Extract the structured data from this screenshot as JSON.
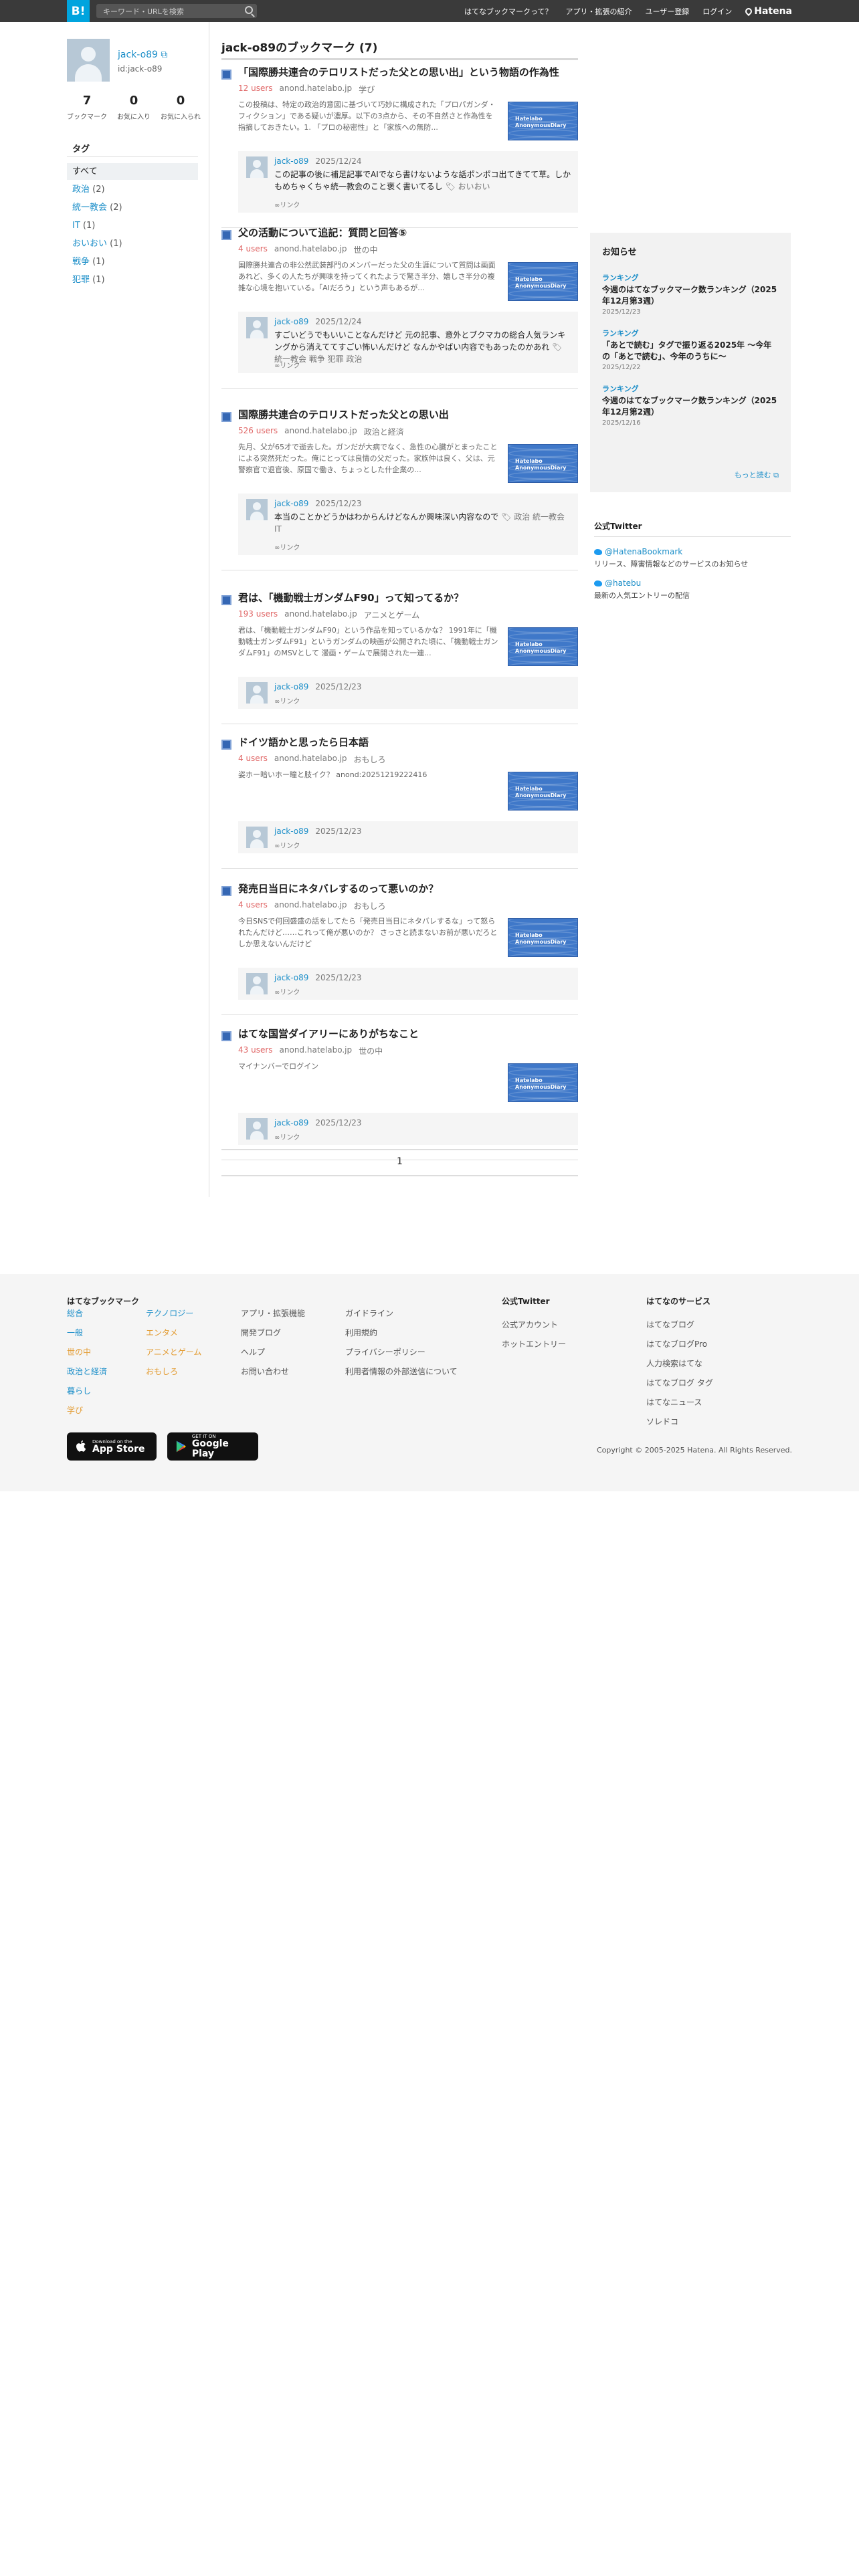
{
  "topbar": {
    "logo": "B!",
    "search_placeholder": "キーワード・URLを検索",
    "nav": [
      "はてなブックマークって？",
      "アプリ・拡張の紹介",
      "ユーザー登録",
      "ログイン"
    ],
    "hatena": "Hatena"
  },
  "profile": {
    "name": "jack-o89",
    "id": "id:jack-o89",
    "stats": [
      {
        "n": "7",
        "l": "ブックマーク"
      },
      {
        "n": "0",
        "l": "お気に入り"
      },
      {
        "n": "0",
        "l": "お気に入られ"
      }
    ]
  },
  "tags": {
    "title": "タグ",
    "items": [
      {
        "label": "すべて",
        "count": ""
      },
      {
        "label": "政治",
        "count": "(2)"
      },
      {
        "label": "統一教会",
        "count": "(2)"
      },
      {
        "label": "IT",
        "count": "(1)"
      },
      {
        "label": "おいおい",
        "count": "(1)"
      },
      {
        "label": "戦争",
        "count": "(1)"
      },
      {
        "label": "犯罪",
        "count": "(1)"
      }
    ]
  },
  "main": {
    "title": "jack-o89のブックマーク (7)",
    "page": "1"
  },
  "entries": [
    {
      "title": "「国際勝共連合のテロリストだった父との思い出」という物語の作為性",
      "users": "12 users",
      "domain": "anond.hatelabo.jp",
      "cat": "学び",
      "desc": "この投稿は、特定の政治的意図に基づいて巧妙に構成された「プロパガンダ・フィクション」である疑いが濃厚。以下の3点から、その不自然さと作為性を指摘しておきたい。1. 「プロの秘密性」と「家族への無防...",
      "cuser": "jack-o89",
      "cdate": "2025/12/24",
      "ctext": "この記事の後に補足記事でAIでなら書けないような話ポンポコ出てきてて草。しかもめちゃくちゃ統一教会のこと褒く書いてるし",
      "ctags": "おいおい",
      "clink": "リンク"
    },
    {
      "title": "父の活動について追記：質問と回答⑤",
      "users": "4 users",
      "domain": "anond.hatelabo.jp",
      "cat": "世の中",
      "desc": "国際勝共連合の非公然武装部門のメンバーだった父の生涯について質問は画面あれど、多くの人たちが興味を持ってくれたようで驚き半分、嬉しさ半分の複雑な心境を抱いている。「AIだろう」という声もあるが...",
      "cuser": "jack-o89",
      "cdate": "2025/12/24",
      "ctext": "すごいどうでもいいことなんだけど 元の記事、意外とブクマカの総合人気ランキングから消えててすごい怖いんだけど なんかやばい内容でもあったのかあれ",
      "ctags": "統一教会 戦争 犯罪 政治",
      "clink": "リンク"
    },
    {
      "title": "国際勝共連合のテロリストだった父との思い出",
      "users": "526 users",
      "domain": "anond.hatelabo.jp",
      "cat": "政治と経済",
      "desc": "先月、父が65才で逝去した。ガンだが大病でなく、急性の心臓がとまったことによる突然死だった。俺にとっては良情の父だった。家族仲は良く、父は、元警察官で退官後、原国で働き、ちょっとした什企業の...",
      "cuser": "jack-o89",
      "cdate": "2025/12/23",
      "ctext": "本当のことかどうかはわからんけどなんか興味深い内容なので",
      "ctags": "政治 統一教会 IT",
      "clink": "リンク"
    },
    {
      "title": "君は、「機動戦士ガンダムF90」って知ってるか？",
      "users": "193 users",
      "domain": "anond.hatelabo.jp",
      "cat": "アニメとゲーム",
      "desc": "君は、「機動戦士ガンダムF90」という作品を知っているかな？ 1991年に「機動戦士ガンダムF91」というガンダムの映画が公開された頃に、「機動戦士ガンダムF91」のMSVとして 漫画・ゲームで展開された一連...",
      "cuser": "jack-o89",
      "cdate": "2025/12/23",
      "ctext": "",
      "ctags": "",
      "clink": "リンク"
    },
    {
      "title": "ドイツ語かと思ったら日本語",
      "users": "4 users",
      "domain": "anond.hatelabo.jp",
      "cat": "おもしろ",
      "desc": "姿ホー暗いホー瞳と肢イク？ anond:20251219222416",
      "cuser": "jack-o89",
      "cdate": "2025/12/23",
      "ctext": "",
      "ctags": "",
      "clink": "リンク"
    },
    {
      "title": "発売日当日にネタバレするのって悪いのか？",
      "users": "4 users",
      "domain": "anond.hatelabo.jp",
      "cat": "おもしろ",
      "desc": "今日SNSで何回盛盛の話をしてたら「発売日当日にネタバレするな」って怒られたんだけど……これって俺が悪いのか？ さっさと読まないお前が悪いだろとしか思えないんだけど",
      "cuser": "jack-o89",
      "cdate": "2025/12/23",
      "ctext": "",
      "ctags": "",
      "clink": "リンク"
    },
    {
      "title": "はてな国営ダイアリーにありがちなこと",
      "users": "43 users",
      "domain": "anond.hatelabo.jp",
      "cat": "世の中",
      "desc": "マイナンバーでログイン",
      "cuser": "jack-o89",
      "cdate": "2025/12/23",
      "ctext": "",
      "ctags": "",
      "clink": "リンク"
    }
  ],
  "thumb_text": "Hatelabo\nAnonymousDiary",
  "notice": {
    "title": "お知らせ",
    "items": [
      {
        "cat": "ランキング",
        "t": "今週のはてなブックマーク数ランキング（2025年12月第3週）",
        "d": "2025/12/23"
      },
      {
        "cat": "ランキング",
        "t": "「あとで読む」タグで振り返る2025年 〜今年の「あとで読む」、今年のうちに〜",
        "d": "2025/12/22"
      },
      {
        "cat": "ランキング",
        "t": "今週のはてなブックマーク数ランキング（2025年12月第2週）",
        "d": "2025/12/16"
      }
    ],
    "more": "もっと読む"
  },
  "twitter": {
    "title": "公式Twitter",
    "items": [
      {
        "h": "@HatenaBookmark",
        "s": "リリース、障害情報などのサービスのお知らせ"
      },
      {
        "h": "@hatebu",
        "s": "最新の人気エントリーの配信"
      }
    ]
  },
  "footer": {
    "col1": {
      "title": "はてなブックマーク",
      "a": [
        "総合",
        "一般",
        "世の中",
        "政治と経済",
        "暮らし",
        "学び"
      ],
      "b": [
        "テクノロジー",
        "エンタメ",
        "アニメとゲーム",
        "おもしろ"
      ],
      "c": [
        "アプリ・拡張機能",
        "開発ブログ",
        "ヘルプ",
        "お問い合わせ"
      ],
      "d": [
        "ガイドライン",
        "利用規約",
        "プライバシーポリシー",
        "利用者情報の外部送信について"
      ]
    },
    "col2": {
      "title": "公式Twitter",
      "items": [
        "公式アカウント",
        "ホットエントリー"
      ]
    },
    "col3": {
      "title": "はてなのサービス",
      "items": [
        "はてなブログ",
        "はてなブログPro",
        "人力検索はてな",
        "はてなブログ タグ",
        "はてなニュース",
        "ソレドコ"
      ]
    },
    "appstore": {
      "small": "Download on the",
      "big": "App Store"
    },
    "googleplay": {
      "small": "GET IT ON",
      "big": "Google Play"
    },
    "copyright": "Copyright © 2005-2025 Hatena. All Rights Reserved."
  },
  "colors": {
    "accent": "#00a4de",
    "link": "#1d8fc9",
    "users": "#e06666",
    "topbar": "#3a3a3a"
  }
}
